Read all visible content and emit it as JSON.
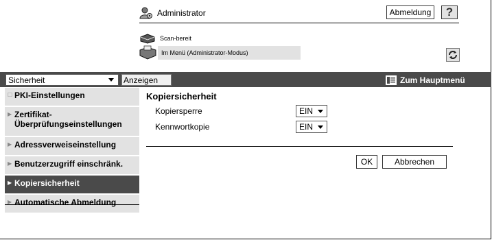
{
  "header": {
    "user": "Administrator",
    "logout_label": "Abmeldung",
    "help_label": "?"
  },
  "status": {
    "device_status": "Scan-bereit",
    "mode": "Im Menü (Administrator-Modus)"
  },
  "toolbar": {
    "category_selected": "Sicherheit",
    "show_label": "Anzeigen",
    "home_label": "Zum Hauptmenü"
  },
  "sidebar": {
    "items": [
      {
        "label": "PKI-Einstellungen"
      },
      {
        "label": "Zertifikat-\nÜberprüfungseinstellungen"
      },
      {
        "label": "Adressverweiseinstellung"
      },
      {
        "label": "Benutzerzugriff einschränk."
      },
      {
        "label": "Kopiersicherheit"
      },
      {
        "label": "Automatische Abmeldung"
      }
    ],
    "active_index": 4
  },
  "main": {
    "title": "Kopiersicherheit",
    "fields": [
      {
        "label": "Kopiersperre",
        "value": "EIN"
      },
      {
        "label": "Kennwortkopie",
        "value": "EIN"
      }
    ],
    "ok_label": "OK",
    "cancel_label": "Abbrechen"
  },
  "colors": {
    "bar": "#4a4a4a",
    "panel": "#e2e2e2"
  },
  "icons": [
    "admin-user-icon",
    "printer-icon",
    "menu-mode-icon",
    "refresh-icon",
    "main-menu-icon",
    "help-icon"
  ]
}
